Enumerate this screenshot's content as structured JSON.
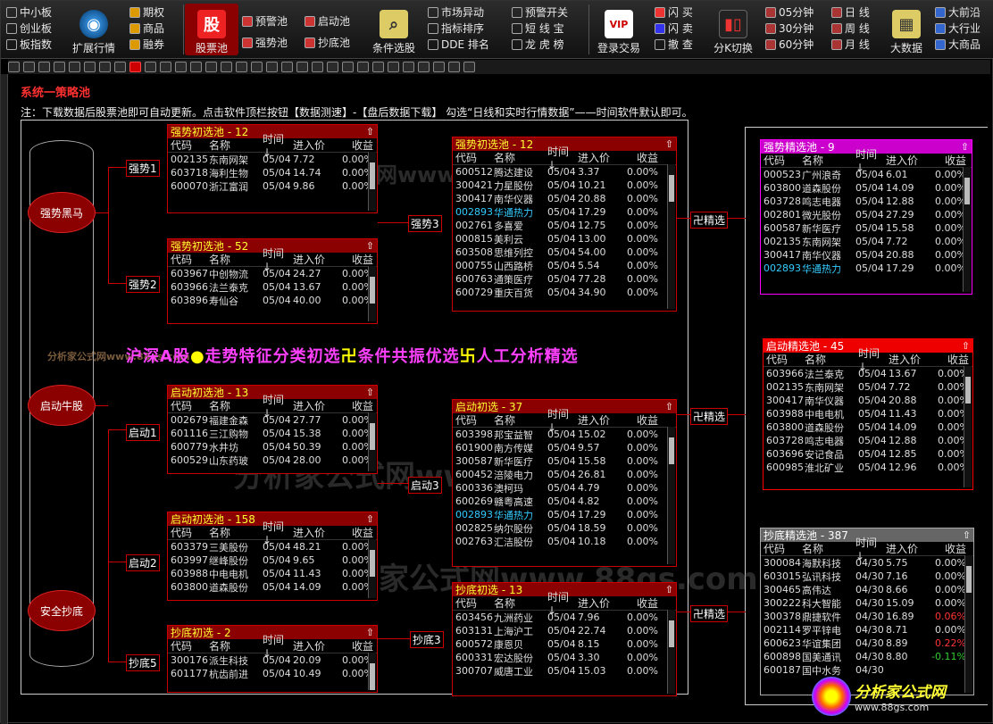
{
  "toolbar": {
    "col1": [
      "中小板",
      "创业板",
      "板指数"
    ],
    "market_label": "扩展行情",
    "col2": [
      "期权",
      "商品",
      "融券"
    ],
    "stockpool_label": "股票池",
    "col3": [
      "预警池",
      "强势池"
    ],
    "col4": [
      "启动池",
      "抄底池"
    ],
    "condition_label": "条件选股",
    "col5": [
      "市场异动",
      "指标排序",
      "DDE 排名"
    ],
    "col6": [
      "预警开关",
      "短 线 宝",
      "龙 虎 榜"
    ],
    "login_label": "登录交易",
    "col7": [
      "闪 买",
      "闪 卖",
      "撤 查"
    ],
    "kline_label": "分K切换",
    "col8": [
      "05分钟",
      "30分钟",
      "60分钟"
    ],
    "col9": [
      "日 线",
      "周 线",
      "月 线"
    ],
    "bigdata_label": "大数据",
    "col10": [
      "大前沿",
      "大行业",
      "大商品"
    ]
  },
  "system_title": "系统一策略池",
  "note": "注：下载数据后股票池即可自动更新。点击软件顶栏按钮【数据测速】-【盘后数据下载】 勾选“日线和实时行情数据”——时间软件默认即可。",
  "categories": [
    "强势黑马",
    "启动牛股",
    "安全抄底"
  ],
  "banner": {
    "p1": "沪深A股",
    "s1": "●",
    "p2": "走势特征分类初选",
    "s2": "卍",
    "p3": "条件共振优选",
    "s3": "卐",
    "p4": "人工分析精选"
  },
  "columns": [
    "代码",
    "名称",
    "时间↓",
    "进入价",
    "收益"
  ],
  "tags": {
    "qs1": "强势1",
    "qs2": "强势2",
    "qs3": "强势3",
    "qd1": "启动1",
    "qd2": "启动2",
    "qd3": "启动3",
    "cd3": "抄底3",
    "cd5": "抄底5",
    "sel1": "卍精选",
    "sel2": "卍精选",
    "sel3": "卍精选"
  },
  "panels": {
    "qs_a": {
      "title": "强势初选池 - 12",
      "rows": [
        [
          "002135",
          "东南网架",
          "05/04",
          "7.72",
          "0.00%",
          ""
        ],
        [
          "603718",
          "海利生物",
          "05/04",
          "14.74",
          "0.00%",
          ""
        ],
        [
          "600070",
          "浙江富润",
          "05/04",
          "9.86",
          "0.00%",
          ""
        ]
      ]
    },
    "qs_b": {
      "title": "强势初选池 - 52",
      "rows": [
        [
          "603967",
          "中创物流",
          "05/04",
          "24.27",
          "0.00%",
          ""
        ],
        [
          "603966",
          "法兰泰克",
          "05/04",
          "13.67",
          "0.00%",
          ""
        ],
        [
          "603896",
          "寿仙谷",
          "05/04",
          "40.00",
          "0.00%",
          ""
        ]
      ]
    },
    "qs_c": {
      "title": "强势初选池 - 12",
      "rows": [
        [
          "600512",
          "腾达建设",
          "05/04",
          "3.37",
          "0.00%",
          ""
        ],
        [
          "300421",
          "力星股份",
          "05/04",
          "10.21",
          "0.00%",
          ""
        ],
        [
          "300417",
          "南华仪器",
          "05/04",
          "20.88",
          "0.00%",
          ""
        ],
        [
          "002893",
          "华通热力",
          "05/04",
          "17.29",
          "0.00%",
          "cyan"
        ],
        [
          "002761",
          "多喜爱",
          "05/04",
          "12.75",
          "0.00%",
          ""
        ],
        [
          "000815",
          "美利云",
          "05/04",
          "13.00",
          "0.00%",
          ""
        ],
        [
          "603508",
          "思维列控",
          "05/04",
          "54.00",
          "0.00%",
          ""
        ],
        [
          "000755",
          "山西路桥",
          "05/04",
          "5.54",
          "0.00%",
          ""
        ],
        [
          "600763",
          "通策医疗",
          "05/04",
          "77.28",
          "0.00%",
          ""
        ],
        [
          "600729",
          "重庆百货",
          "05/04",
          "34.90",
          "0.00%",
          ""
        ]
      ]
    },
    "qd_a": {
      "title": "启动初选池 - 13",
      "rows": [
        [
          "002679",
          "福建金森",
          "05/04",
          "27.77",
          "0.00%",
          ""
        ],
        [
          "601116",
          "三江购物",
          "05/04",
          "15.38",
          "0.00%",
          ""
        ],
        [
          "600779",
          "水井坊",
          "05/04",
          "50.39",
          "0.00%",
          ""
        ],
        [
          "600529",
          "山东药玻",
          "05/04",
          "28.00",
          "0.00%",
          ""
        ]
      ]
    },
    "qd_b": {
      "title": "启动初选池 - 158",
      "rows": [
        [
          "603379",
          "三美股份",
          "05/04",
          "48.21",
          "0.00%",
          ""
        ],
        [
          "603997",
          "继峰股份",
          "05/04",
          "9.65",
          "0.00%",
          ""
        ],
        [
          "603988",
          "中电电机",
          "05/04",
          "11.43",
          "0.00%",
          ""
        ],
        [
          "603800",
          "道森股份",
          "05/04",
          "14.09",
          "0.00%",
          ""
        ]
      ]
    },
    "qd_c": {
      "title": "启动初选 - 37",
      "rows": [
        [
          "603398",
          "邦宝益智",
          "05/04",
          "15.02",
          "0.00%",
          ""
        ],
        [
          "601900",
          "南方传媒",
          "05/04",
          "9.57",
          "0.00%",
          ""
        ],
        [
          "300587",
          "新华医疗",
          "05/04",
          "15.58",
          "0.00%",
          ""
        ],
        [
          "600452",
          "涪陵电力",
          "05/04",
          "26.81",
          "0.00%",
          ""
        ],
        [
          "600336",
          "澳柯玛",
          "05/04",
          "4.79",
          "0.00%",
          ""
        ],
        [
          "600269",
          "赣粤高速",
          "05/04",
          "4.82",
          "0.00%",
          ""
        ],
        [
          "002893",
          "华通热力",
          "05/04",
          "17.29",
          "0.00%",
          "cyan"
        ],
        [
          "002825",
          "纳尔股份",
          "05/04",
          "18.59",
          "0.00%",
          ""
        ],
        [
          "002763",
          "汇洁股份",
          "05/04",
          "10.18",
          "0.00%",
          ""
        ]
      ]
    },
    "cd_a": {
      "title": "抄底初选 - 2",
      "rows": [
        [
          "300176",
          "派生科技",
          "05/04",
          "20.09",
          "0.00%",
          ""
        ],
        [
          "601177",
          "杭齿前进",
          "05/04",
          "10.49",
          "0.00%",
          ""
        ]
      ]
    },
    "cd_c": {
      "title": "抄底初选 - 13",
      "rows": [
        [
          "603456",
          "九洲药业",
          "05/04",
          "7.96",
          "0.00%",
          ""
        ],
        [
          "603131",
          "上海沪工",
          "05/04",
          "22.74",
          "0.00%",
          ""
        ],
        [
          "600572",
          "康恩贝",
          "05/04",
          "8.15",
          "0.00%",
          ""
        ],
        [
          "600331",
          "宏达股份",
          "05/04",
          "3.30",
          "0.00%",
          ""
        ],
        [
          "300707",
          "威唐工业",
          "05/04",
          "15.03",
          "0.00%",
          ""
        ]
      ]
    },
    "sel_qs": {
      "title": "强势精选池 - 9",
      "rows": [
        [
          "000523",
          "广州浪奇",
          "05/04",
          "6.01",
          "0.00%",
          ""
        ],
        [
          "603800",
          "道森股份",
          "05/04",
          "14.09",
          "0.00%",
          ""
        ],
        [
          "603728",
          "鸣志电器",
          "05/04",
          "12.88",
          "0.00%",
          ""
        ],
        [
          "002801",
          "微光股份",
          "05/04",
          "27.29",
          "0.00%",
          ""
        ],
        [
          "600587",
          "新华医疗",
          "05/04",
          "15.58",
          "0.00%",
          ""
        ],
        [
          "002135",
          "东南网架",
          "05/04",
          "7.72",
          "0.00%",
          ""
        ],
        [
          "300417",
          "南华仪器",
          "05/04",
          "20.88",
          "0.00%",
          ""
        ],
        [
          "002893",
          "华通热力",
          "05/04",
          "17.29",
          "0.00%",
          "cyan"
        ]
      ]
    },
    "sel_qd": {
      "title": "启动精选池 - 45",
      "rows": [
        [
          "603966",
          "法兰泰克",
          "05/04",
          "13.67",
          "0.00%",
          ""
        ],
        [
          "002135",
          "东南网架",
          "05/04",
          "7.72",
          "0.00%",
          ""
        ],
        [
          "300417",
          "南华仪器",
          "05/04",
          "20.88",
          "0.00%",
          ""
        ],
        [
          "603988",
          "中电电机",
          "05/04",
          "11.43",
          "0.00%",
          ""
        ],
        [
          "603800",
          "道森股份",
          "05/04",
          "14.09",
          "0.00%",
          ""
        ],
        [
          "603728",
          "鸣志电器",
          "05/04",
          "12.88",
          "0.00%",
          ""
        ],
        [
          "603696",
          "安记食品",
          "05/04",
          "12.85",
          "0.00%",
          ""
        ],
        [
          "600985",
          "淮北矿业",
          "05/04",
          "12.96",
          "0.00%",
          ""
        ]
      ]
    },
    "sel_cd": {
      "title": "抄底精选池 - 387",
      "rows": [
        [
          "300084",
          "海默科技",
          "04/30",
          "5.75",
          "0.00%",
          ""
        ],
        [
          "603015",
          "弘讯科技",
          "04/30",
          "7.16",
          "0.00%",
          ""
        ],
        [
          "300465",
          "高伟达",
          "04/30",
          "8.66",
          "0.00%",
          ""
        ],
        [
          "300222",
          "科大智能",
          "04/30",
          "15.09",
          "0.00%",
          ""
        ],
        [
          "300378",
          "鼎捷软件",
          "04/30",
          "16.89",
          "0.06%",
          "red"
        ],
        [
          "002114",
          "罗平锌电",
          "04/30",
          "8.71",
          "0.00%",
          ""
        ],
        [
          "600623",
          "华谊集团",
          "04/30",
          "8.89",
          "0.22%",
          "red"
        ],
        [
          "600898",
          "国美通讯",
          "04/30",
          "8.80",
          "-0.11%",
          "green"
        ],
        [
          "600187",
          "国中水务",
          "04/30",
          "",
          "",
          ""
        ]
      ]
    }
  },
  "watermark1": "分析家公式网www.88gs.com",
  "watermark2": "分析家公式网www.88gs.com",
  "watermark3": "分析家公式网www.88gs.com",
  "watermark_small": "分析家公式网www.88gs.com",
  "logo": {
    "t1": "分析家公式网",
    "t2": "www.88gs.com"
  }
}
